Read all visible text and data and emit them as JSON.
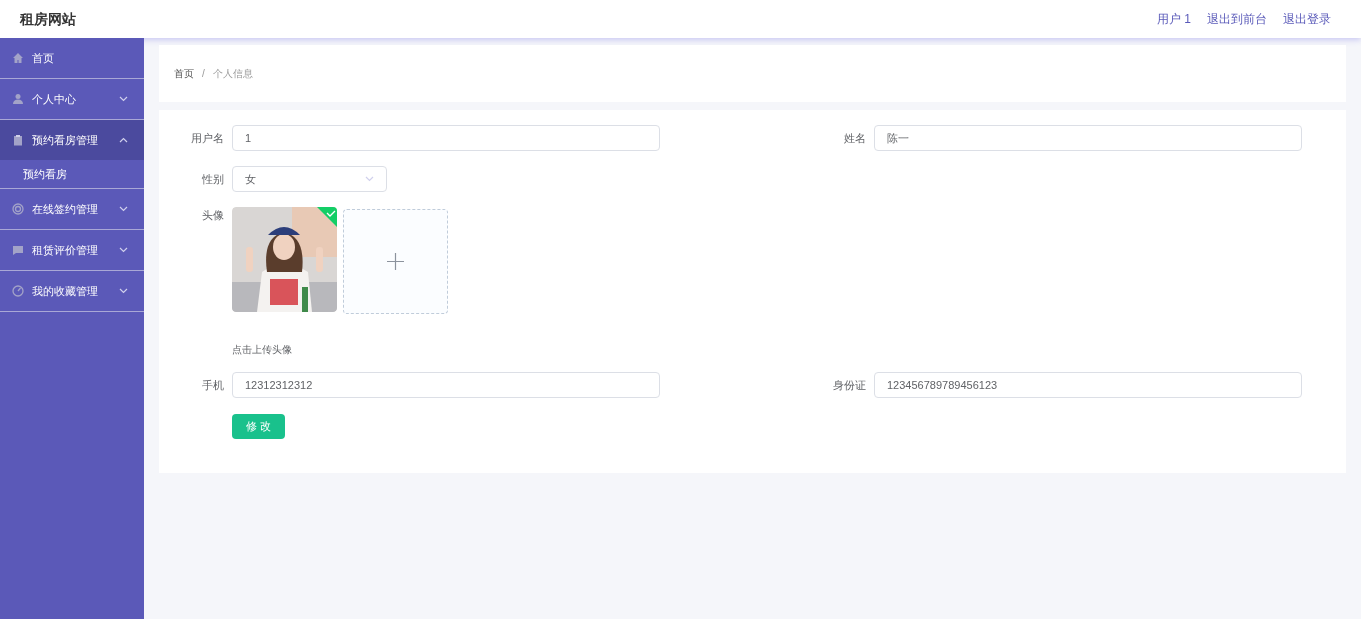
{
  "header": {
    "title": "租房网站",
    "links": [
      "用户 1",
      "退出到前台",
      "退出登录"
    ]
  },
  "sidebar": {
    "items": [
      {
        "label": "首页",
        "kind": "home",
        "selected": false
      },
      {
        "label": "个人中心",
        "kind": "user",
        "selected": false,
        "expanded": false
      },
      {
        "label": "预约看房管理",
        "kind": "clipboard",
        "selected": true,
        "expanded": true,
        "children": [
          {
            "label": "预约看房",
            "selected": false
          }
        ]
      },
      {
        "label": "在线签约管理",
        "kind": "ring",
        "selected": false,
        "expanded": false
      },
      {
        "label": "租赁评价管理",
        "kind": "chat",
        "selected": false,
        "expanded": false
      },
      {
        "label": "我的收藏管理",
        "kind": "gauge",
        "selected": false,
        "expanded": false
      }
    ]
  },
  "breadcrumb": [
    "首页",
    "/",
    "个人信息"
  ],
  "form": {
    "username": {
      "label": "用户名",
      "value": "1"
    },
    "name": {
      "label": "姓名",
      "value": "陈一"
    },
    "gender": {
      "label": "性别",
      "value": "女"
    },
    "avatar": {
      "label": "头像",
      "uploaded": true,
      "hint": "点击上传头像"
    },
    "phone": {
      "label": "手机",
      "value": "12312312312"
    },
    "id_card": {
      "label": "身份证",
      "value": "123456789789456123"
    },
    "submit": "修 改"
  }
}
